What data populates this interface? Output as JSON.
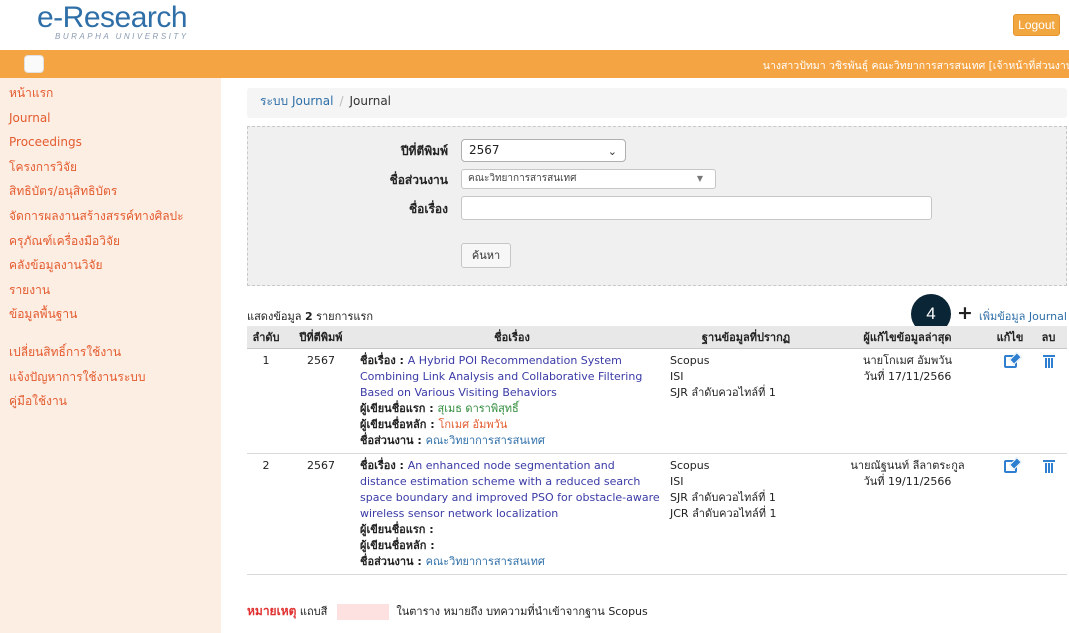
{
  "header": {
    "logo_main": "e-Research",
    "logo_sub": "BURAPHA UNIVERSITY",
    "logout_label": "Logout",
    "user_info": "นางสาวปัทมา วชิรพันธุ์  คณะวิทยาการสารสนเทศ  [เจ้าหน้าที่ส่วนงาน"
  },
  "sidebar": {
    "items": [
      {
        "label": "หน้าแรก"
      },
      {
        "label": "Journal"
      },
      {
        "label": "Proceedings"
      },
      {
        "label": "โครงการวิจัย"
      },
      {
        "label": "สิทธิบัตร/อนุสิทธิบัตร"
      },
      {
        "label": "จัดการผลงานสร้างสรรค์ทางศิลปะ"
      },
      {
        "label": "ครุภัณฑ์เครื่องมือวิจัย"
      },
      {
        "label": "คลังข้อมูลงานวิจัย"
      },
      {
        "label": "รายงาน"
      },
      {
        "label": "ข้อมูลพื้นฐาน"
      }
    ],
    "secondary": [
      {
        "label": "เปลี่ยนสิทธิ์การใช้งาน"
      },
      {
        "label": "แจ้งปัญหาการใช้งานระบบ"
      },
      {
        "label": "คู่มือใช้งาน"
      }
    ]
  },
  "breadcrumb": {
    "root": "ระบบ Journal",
    "separator": "/",
    "current": "Journal"
  },
  "search": {
    "year_label": "ปีที่ตีพิมพ์",
    "year_value": "2567",
    "dept_label": "ชื่อส่วนงาน",
    "dept_value": "คณะวิทยาการสารสนเทศ",
    "title_label": "ชื่อเรื่อง",
    "title_value": "",
    "search_button": "ค้นหา"
  },
  "results": {
    "count_prefix": "แสดงข้อมูล",
    "count": "2",
    "count_suffix": "รายการแรก",
    "add_label": "เพิ่มข้อมูล Journal",
    "badge": "4"
  },
  "table": {
    "headers": {
      "no": "ลำดับ",
      "year": "ปีที่ตีพิมพ์",
      "title": "ชื่อเรื่อง",
      "db": "ฐานข้อมูลที่ปรากฏ",
      "editor": "ผู้แก้ไขข้อมูลล่าสุด",
      "edit": "แก้ไข",
      "delete": "ลบ"
    },
    "labels": {
      "title": "ชื่อเรื่อง : ",
      "first_author": "ผู้เขียนชื่อแรก : ",
      "main_author": "ผู้เขียนชื่อหลัก : ",
      "dept": "ชื่อส่วนงาน : "
    },
    "rows": [
      {
        "no": "1",
        "year": "2567",
        "title": "A Hybrid POI Recommendation System Combining Link Analysis and Collaborative Filtering Based on Various Visiting Behaviors",
        "first_author": "สุเมธ ดาราพิสุทธิ์",
        "main_author": "โกเมศ อัมพวัน",
        "dept": "คณะวิทยาการสารสนเทศ",
        "db": [
          "Scopus",
          "ISI",
          "SJR ลำดับควอไทล์ที่ 1"
        ],
        "editor": "นายโกเมศ อัมพวัน",
        "edited_on": "วันที่ 17/11/2566"
      },
      {
        "no": "2",
        "year": "2567",
        "title": "An enhanced node segmentation and distance estimation scheme with a reduced search space boundary and improved PSO for obstacle-aware wireless sensor network localization",
        "first_author": "",
        "main_author": "",
        "dept": "คณะวิทยาการสารสนเทศ",
        "db": [
          "Scopus",
          "ISI",
          "SJR ลำดับควอไทล์ที่ 1",
          "JCR ลำดับควอไทล์ที่ 1"
        ],
        "editor": "นายณัฐนนท์ ลีลาตระกูล",
        "edited_on": "วันที่ 19/11/2566"
      }
    ]
  },
  "note": {
    "label": "หมายเหตุ",
    "text1": "แถบสี",
    "text2": "ในตาราง หมายถึง บทความที่นำเข้าจากฐาน Scopus"
  },
  "colors": {
    "accent": "#f5a443",
    "sidebar_bg": "#fdeee4",
    "link": "#2f6fa8",
    "sidebar_link": "#e35b2e",
    "scopus_row": "#fde1e1"
  },
  "icons": [
    "menu-toggle-icon",
    "plus-icon",
    "edit-icon",
    "trash-icon",
    "chevron-down-icon"
  ]
}
